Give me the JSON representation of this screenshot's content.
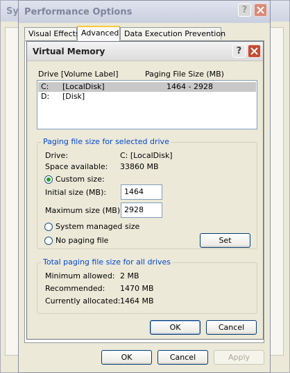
{
  "system_window": {
    "title": "Sys"
  },
  "performance_window": {
    "title": "Performance Options",
    "tabs": [
      {
        "label": "Visual Effects",
        "active": false
      },
      {
        "label": "Advanced",
        "active": true
      },
      {
        "label": "Data Execution Prevention",
        "active": false
      }
    ],
    "buttons": {
      "ok": "OK",
      "cancel": "Cancel",
      "apply": "Apply"
    }
  },
  "virtual_memory": {
    "title": "Virtual Memory",
    "list_headers": {
      "drive": "Drive  [Volume Label]",
      "paging": "Paging File Size (MB)"
    },
    "drives": [
      {
        "letter": "C:",
        "label": "[LocalDisk]",
        "size": "1464 - 2928",
        "selected": true
      },
      {
        "letter": "D:",
        "label": "[Disk]",
        "size": "",
        "selected": false
      }
    ],
    "selected_group": {
      "title": "Paging file size for selected drive",
      "drive_label": "Drive:",
      "drive_value": "C:  [LocalDisk]",
      "space_label": "Space available:",
      "space_value": "33860 MB",
      "custom_label": "Custom size:",
      "initial_label": "Initial size (MB):",
      "initial_value": "1464",
      "max_label": "Maximum size (MB):",
      "max_value": "2928",
      "system_label": "System managed size",
      "none_label": "No paging file",
      "set_label": "Set",
      "selected_option": "custom"
    },
    "totals_group": {
      "title": "Total paging file size for all drives",
      "min_label": "Minimum allowed:",
      "min_value": "2 MB",
      "rec_label": "Recommended:",
      "rec_value": "1470 MB",
      "cur_label": "Currently allocated:",
      "cur_value": "1464 MB"
    },
    "buttons": {
      "ok": "OK",
      "cancel": "Cancel"
    }
  },
  "colors": {
    "accent_group_title": "#0046d5",
    "close_button": "#c24c34",
    "radio_dot": "#21a121"
  },
  "icons": [
    "help-icon",
    "close-icon"
  ]
}
